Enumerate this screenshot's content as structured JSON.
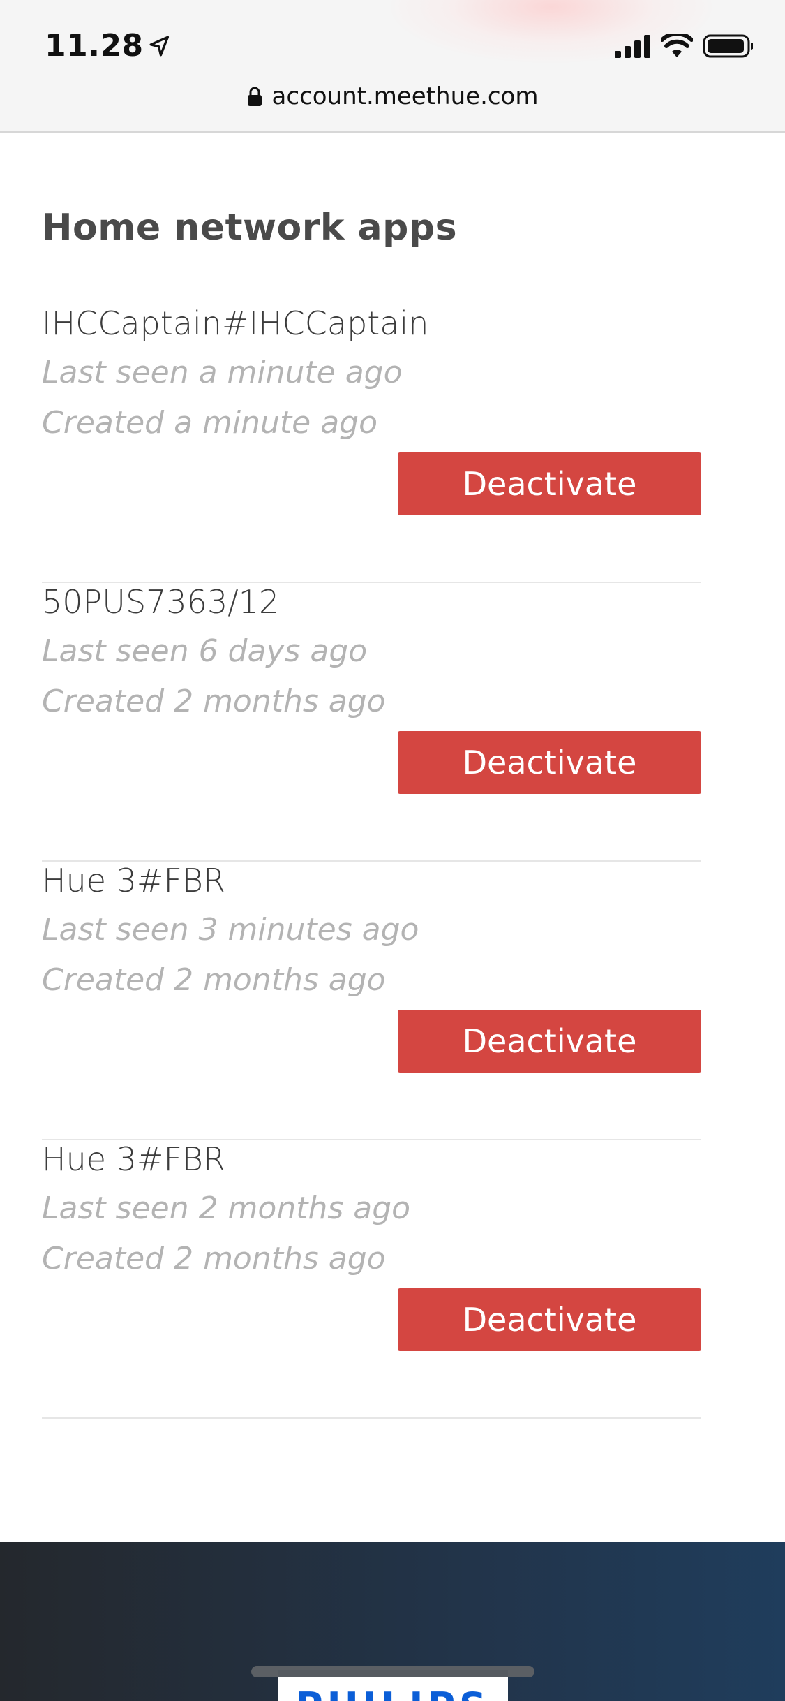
{
  "status_bar": {
    "time": "11.28",
    "icons": [
      "location-arrow-icon",
      "cellular-signal-icon",
      "wifi-icon",
      "battery-icon"
    ]
  },
  "browser": {
    "url": "account.meethue.com",
    "icons": [
      "lock-icon"
    ]
  },
  "main": {
    "title": "Home network apps",
    "apps": [
      {
        "name": "IHCCaptain#IHCCaptain",
        "last_seen": "Last seen a minute ago",
        "created": "Created a minute ago",
        "button_label": "Deactivate"
      },
      {
        "name": "50PUS7363/12",
        "last_seen": "Last seen 6 days ago",
        "created": "Created 2 months ago",
        "button_label": "Deactivate"
      },
      {
        "name": "Hue 3#FBR",
        "last_seen": "Last seen 3 minutes ago",
        "created": "Created 2 months ago",
        "button_label": "Deactivate"
      },
      {
        "name": "Hue 3#FBR",
        "last_seen": "Last seen 2 months ago",
        "created": "Created 2 months ago",
        "button_label": "Deactivate"
      }
    ]
  },
  "footer": {
    "logo_text": "PHILIPS"
  },
  "colors": {
    "accent": "#d44641",
    "meta_text": "#b3b3b3",
    "footer_dark": "#24282d",
    "footer_blue": "#1f3d5c"
  }
}
